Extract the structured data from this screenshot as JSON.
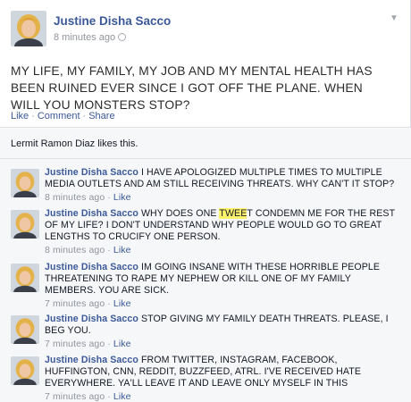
{
  "post": {
    "author": "Justine Disha Sacco",
    "time": "8 minutes ago",
    "text": "MY LIFE, MY FAMILY, MY JOB AND MY MENTAL HEALTH HAS BEEN RUINED EVER SINCE I GOT OFF THE PLANE. WHEN WILL YOU MONSTERS STOP?",
    "actions": {
      "like": "Like",
      "comment": "Comment",
      "share": "Share",
      "separator": "·"
    }
  },
  "likes": {
    "text": "Lermit Ramon Diaz likes this."
  },
  "comments": [
    {
      "name": "Justine Disha Sacco",
      "text": "I HAVE APOLOGIZED MULTIPLE TIMES TO MULTIPLE MEDIA OUTLETS AND AM STILL RECEIVING THREATS. WHY CAN'T IT STOP?",
      "time": "8 minutes ago",
      "like": "Like"
    },
    {
      "name": "Justine Disha Sacco",
      "text_before": "WHY DOES ONE ",
      "text_highlight": "TWEE",
      "text_after": "T CONDEMN ME FOR THE REST OF MY LIFE? I DON'T UNDERSTAND WHY PEOPLE WOULD GO TO GREAT LENGTHS TO CRUCIFY ONE PERSON.",
      "time": "8 minutes ago",
      "like": "Like"
    },
    {
      "name": "Justine Disha Sacco",
      "text": "IM GOING INSANE WITH THESE HORRIBLE PEOPLE THREATENING TO RAPE MY NEPHEW OR KILL ONE OF MY FAMILY MEMBERS. YOU ARE SICK.",
      "time": "7 minutes ago",
      "like": "Like"
    },
    {
      "name": "Justine Disha Sacco",
      "text": "STOP GIVING MY FAMILY DEATH THREATS. PLEASE, I BEG YOU.",
      "time": "7 minutes ago",
      "like": "Like"
    },
    {
      "name": "Justine Disha Sacco",
      "text": "FROM TWITTER, INSTAGRAM, FACEBOOK, HUFFINGTON, CNN, REDDIT, BUZZFEED, ATRL. I'VE RECEIVED HATE EVERYWHERE. YA'LL LEAVE IT AND LEAVE ONLY MYSELF IN THIS",
      "time": "7 minutes ago",
      "like": "Like"
    }
  ],
  "colors": {
    "link": "#3b5998",
    "meta": "#90949c",
    "highlight": "#fff36b",
    "ufi_background": "#f6f7f9"
  },
  "icons": {
    "post_menu": "chevron-down-icon",
    "audience": "globe-icon"
  }
}
